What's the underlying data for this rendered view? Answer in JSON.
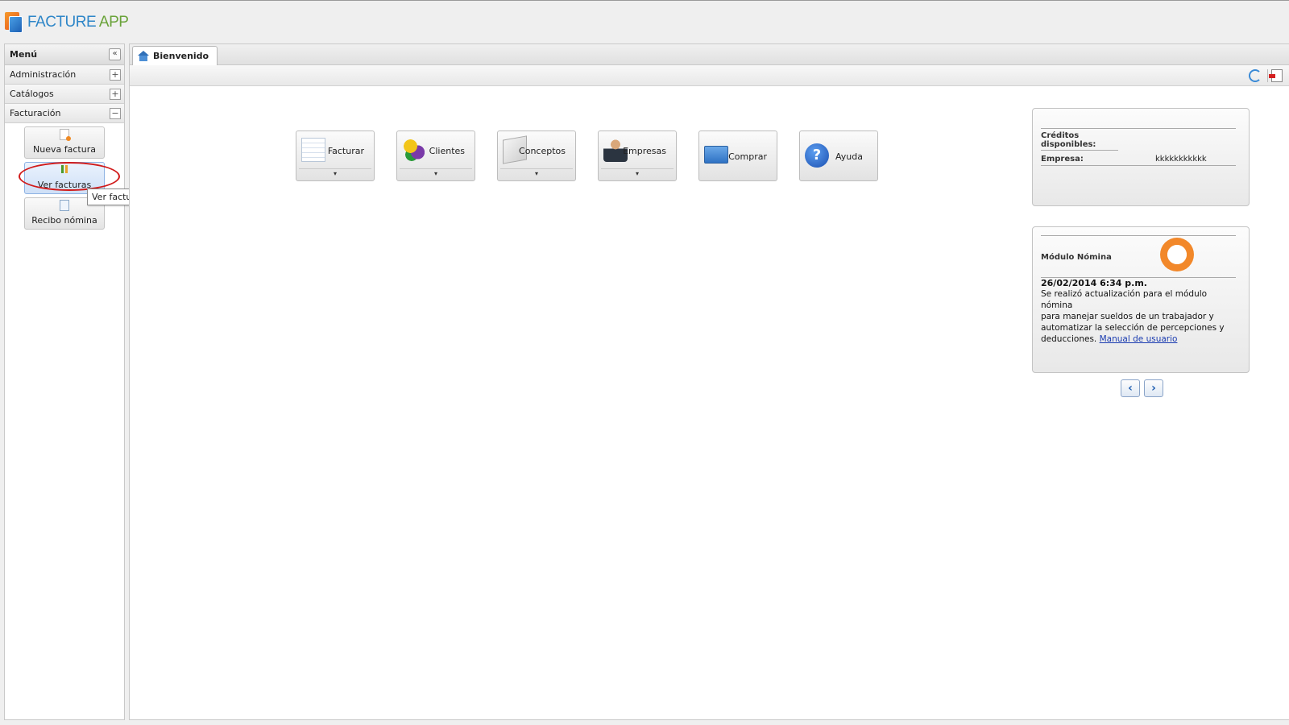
{
  "app": {
    "logo_word1": "FACTURE",
    "logo_word2": "APP"
  },
  "menu": {
    "title": "Menú",
    "collapse_glyph": "«",
    "groups": [
      {
        "label": "Administración",
        "toggle": "+"
      },
      {
        "label": "Catálogos",
        "toggle": "+"
      },
      {
        "label": "Facturación",
        "toggle": "−"
      }
    ],
    "subitems": [
      {
        "label": "Nueva factura",
        "icon": "new-invoice-icon"
      },
      {
        "label": "Ver facturas",
        "icon": "view-invoices-icon"
      },
      {
        "label": "Recibo nómina",
        "icon": "payroll-receipt-icon"
      }
    ],
    "tooltip": "Ver facturas emitidas."
  },
  "tabs": [
    {
      "label": "Bienvenido",
      "icon": "home-icon"
    }
  ],
  "toolbar": {
    "refresh_icon": "refresh-icon",
    "exit_icon": "exit-icon"
  },
  "buttons": [
    {
      "label": "Facturar",
      "dropdown": "▾"
    },
    {
      "label": "Clientes",
      "dropdown": "▾"
    },
    {
      "label": "Conceptos",
      "dropdown": "▾"
    },
    {
      "label": "Empresas",
      "dropdown": "▾"
    },
    {
      "label": "Comprar"
    },
    {
      "label": "Ayuda",
      "icon_glyph": "?"
    }
  ],
  "credits": {
    "label_line1": "Créditos",
    "label_line2": "disponibles:",
    "company_label": "Empresa:",
    "company_value": "kkkkkkkkkkk"
  },
  "news": {
    "title": "Módulo Nómina",
    "date": "26/02/2014 6:34 p.m.",
    "body_line1": "Se realizó actualización para el módulo nómina",
    "body_line2": "para manejar sueldos de un trabajador y",
    "body_line3": "automatizar la selección de percepciones y",
    "body_line4": "deducciones.",
    "link": "Manual de usuario"
  },
  "pager": {
    "prev": "‹",
    "next": "›"
  },
  "colors": {
    "accent_blue": "#2e86c8",
    "logo_green": "#6aa33a",
    "highlight_red": "#d11a1a"
  }
}
